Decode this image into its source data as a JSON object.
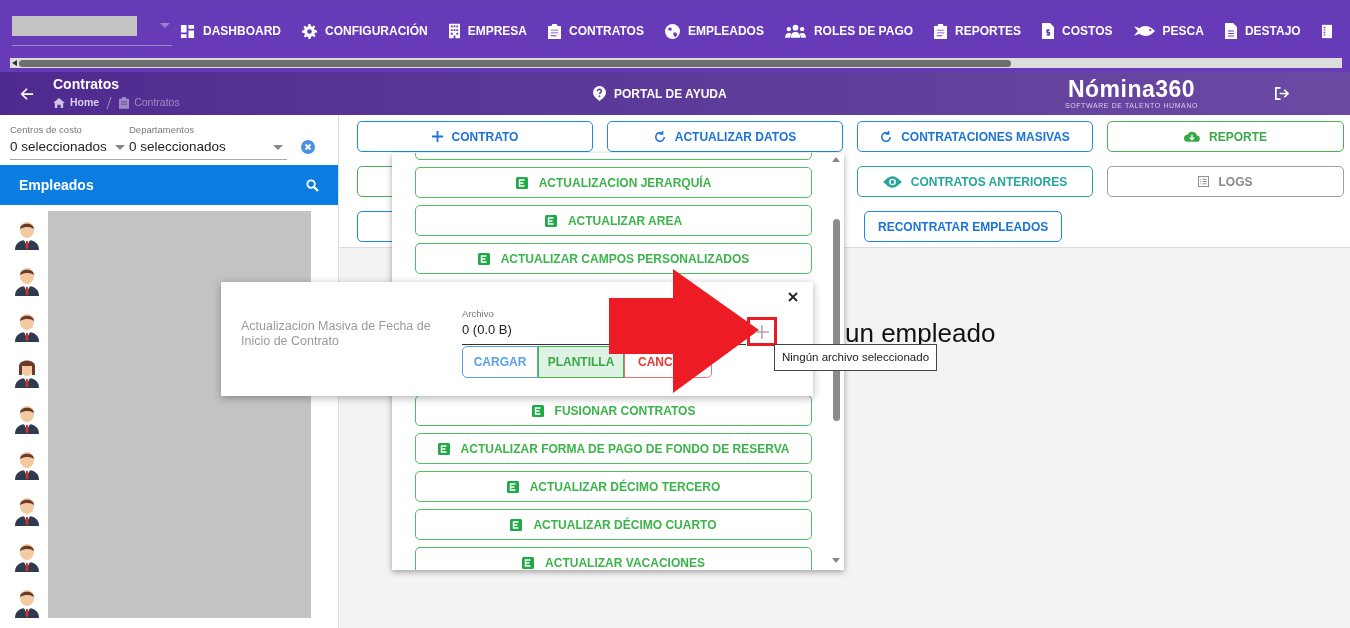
{
  "top_nav": {
    "items": [
      "DASHBOARD",
      "CONFIGURACIÓN",
      "EMPRESA",
      "CONTRATOS",
      "EMPLEADOS",
      "ROLES DE PAGO",
      "REPORTES",
      "COSTOS",
      "PESCA",
      "DESTAJO"
    ]
  },
  "page_header": {
    "title": "Contratos",
    "breadcrumb": [
      "Home",
      "Contratos"
    ],
    "help_link": "PORTAL DE AYUDA",
    "logo": {
      "name": "Nómina360",
      "tagline": "SOFTWARE DE TALENTO HUMANO"
    }
  },
  "filters": [
    {
      "label": "Centros de costo",
      "value": "0 seleccionados"
    },
    {
      "label": "Departamentos",
      "value": "0 seleccionados"
    }
  ],
  "employees_panel": {
    "title": "Empleados",
    "employees": [
      {
        "kind": "male"
      },
      {
        "kind": "male"
      },
      {
        "kind": "male"
      },
      {
        "kind": "female"
      },
      {
        "kind": "male"
      },
      {
        "kind": "male"
      },
      {
        "kind": "male"
      },
      {
        "kind": "male"
      },
      {
        "kind": "male"
      }
    ]
  },
  "actions": [
    [
      {
        "label": "CONTRATO",
        "kind": "primary"
      },
      {
        "label": "ACTUALIZAR DATOS",
        "kind": "primary"
      },
      {
        "label": "CONTRATACIONES MASIVAS",
        "kind": "primary"
      },
      {
        "label": "REPORTE",
        "kind": "success"
      }
    ],
    [
      {
        "kind": "success"
      },
      {
        "kind": "empty"
      },
      {
        "label": "CONTRATOS ANTERIORES",
        "kind": "info"
      },
      {
        "label": "LOGS",
        "kind": "neutral"
      }
    ],
    [
      {
        "kind": "primary"
      },
      {
        "kind": "empty"
      },
      {
        "label": "RECONTRATAR EMPLEADOS",
        "kind": "primary",
        "compact": true
      }
    ]
  ],
  "main_message": "un empleado",
  "menu": {
    "items_above": [
      "ACTUALIZACION JERARQUÍA",
      "ACTUALIZAR AREA",
      "ACTUALIZAR CAMPOS PERSONALIZADOS"
    ],
    "items_below": [
      "FUSIONAR CONTRATOS",
      "ACTUALIZAR FORMA DE PAGO DE FONDO DE RESERVA",
      "ACTUALIZAR DÉCIMO TERCERO",
      "ACTUALIZAR DÉCIMO CUARTO",
      "ACTUALIZAR VACACIONES"
    ]
  },
  "dialog": {
    "title": "Actualizacion Masiva de Fecha de Inicio de Contrato",
    "field_label": "Archivo",
    "field_value": "0 (0.0 B)",
    "buttons": [
      {
        "label": "CARGAR",
        "kind": "primary"
      },
      {
        "label": "PLANTILLA",
        "kind": "success"
      },
      {
        "label": "CANC",
        "kind": "danger"
      }
    ]
  },
  "tooltip": "Ningún archivo seleccionado"
}
